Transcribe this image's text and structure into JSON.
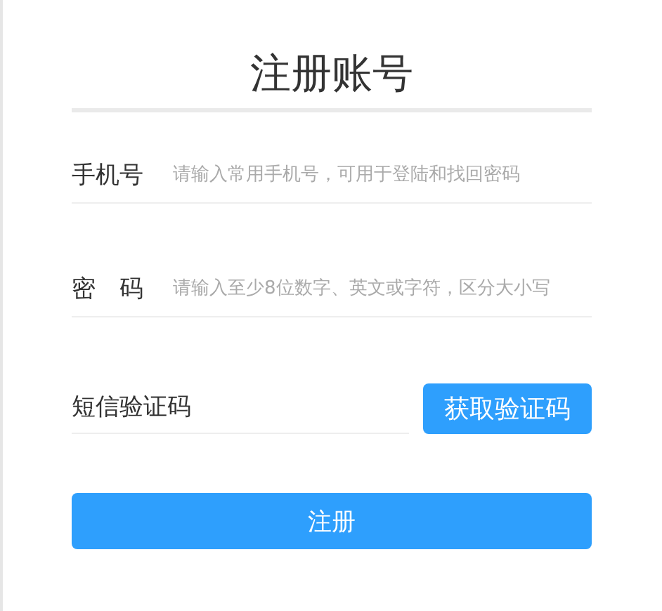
{
  "title": "注册账号",
  "fields": [
    {
      "kind": "labeled",
      "label": "手机号",
      "placeholder": "请输入常用手机号，可用于登陆和找回密码"
    },
    {
      "kind": "labeled",
      "label": "密　码",
      "placeholder": "请输入至少8位数字、英文或字符，区分大小写"
    },
    {
      "kind": "code",
      "placeholder": "短信验证码",
      "button": "获取验证码"
    }
  ],
  "submit": "注册"
}
